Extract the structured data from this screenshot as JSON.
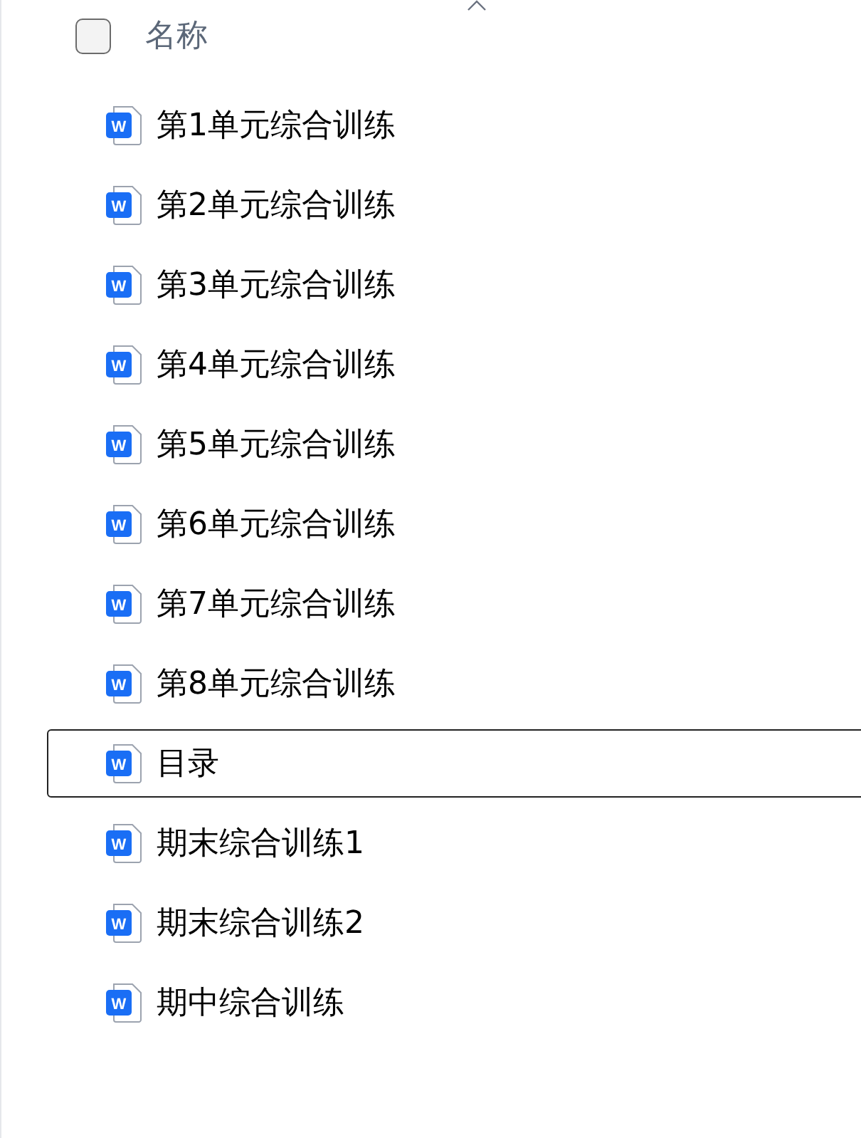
{
  "header": {
    "checked": false,
    "column_label": "名称",
    "sort_ascending": true
  },
  "files": [
    {
      "name": "第1单元综合训练",
      "badge": "W",
      "selected": false
    },
    {
      "name": "第2单元综合训练",
      "badge": "W",
      "selected": false
    },
    {
      "name": "第3单元综合训练",
      "badge": "W",
      "selected": false
    },
    {
      "name": "第4单元综合训练",
      "badge": "W",
      "selected": false
    },
    {
      "name": "第5单元综合训练",
      "badge": "W",
      "selected": false
    },
    {
      "name": "第6单元综合训练",
      "badge": "W",
      "selected": false
    },
    {
      "name": "第7单元综合训练",
      "badge": "W",
      "selected": false
    },
    {
      "name": "第8单元综合训练",
      "badge": "W",
      "selected": false
    },
    {
      "name": "目录",
      "badge": "W",
      "selected": true
    },
    {
      "name": "期末综合训练1",
      "badge": "W",
      "selected": false
    },
    {
      "name": "期末综合训练2",
      "badge": "W",
      "selected": false
    },
    {
      "name": "期中综合训练",
      "badge": "W",
      "selected": false
    }
  ]
}
